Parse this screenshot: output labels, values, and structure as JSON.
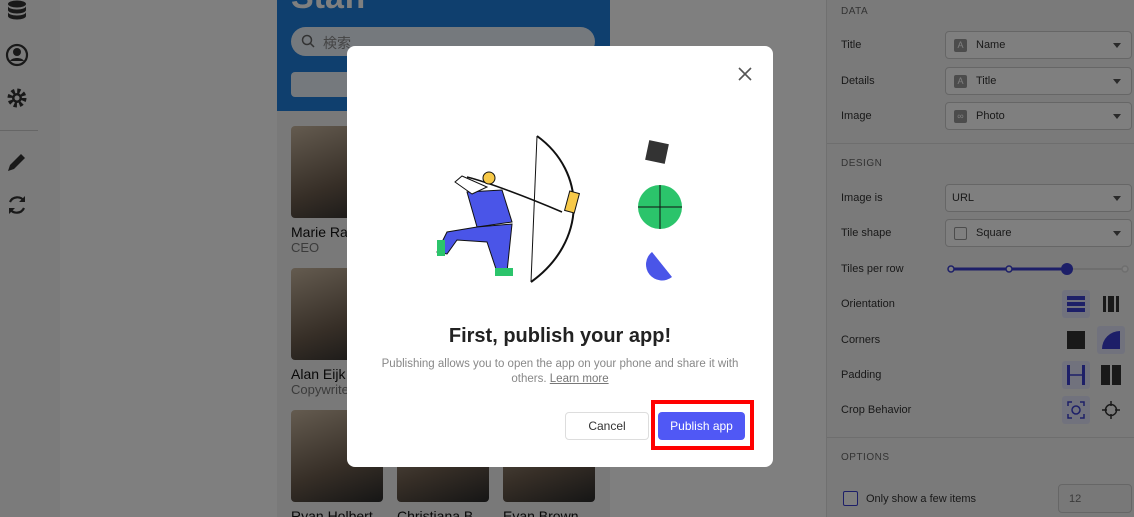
{
  "app": {
    "title": "Staff",
    "search_placeholder": "検索"
  },
  "tiles": [
    {
      "name": "Marie Ra",
      "subtitle": "CEO"
    },
    {
      "name": "Alan Eijk",
      "subtitle": "Copywrite"
    },
    {
      "name": "Ryan Holbert",
      "subtitle": ""
    },
    {
      "name": "Christiana B",
      "subtitle": ""
    },
    {
      "name": "Evan Brown",
      "subtitle": ""
    }
  ],
  "panel": {
    "data_section": "DATA",
    "title_label": "Title",
    "title_value": "Name",
    "details_label": "Details",
    "details_value": "Title",
    "image_label": "Image",
    "image_value": "Photo",
    "design_section": "DESIGN",
    "image_is_label": "Image is",
    "image_is_value": "URL",
    "tile_shape_label": "Tile shape",
    "tile_shape_value": "Square",
    "tiles_per_row_label": "Tiles per row",
    "tiles_per_row_level": 3,
    "tiles_per_row_max": 4,
    "orientation_label": "Orientation",
    "corners_label": "Corners",
    "padding_label": "Padding",
    "crop_label": "Crop Behavior",
    "options_section": "OPTIONS",
    "few_items_label": "Only show a few items",
    "few_items_checked": false,
    "few_items_placeholder": "12"
  },
  "modal": {
    "title": "First, publish your app!",
    "description": "Publishing allows you to open the app on your phone and share it with others.",
    "learn_more": "Learn more",
    "cancel": "Cancel",
    "publish": "Publish app"
  },
  "colors": {
    "accent": "#5058f5",
    "header": "#1f7fdc",
    "highlight": "#ff0000"
  }
}
